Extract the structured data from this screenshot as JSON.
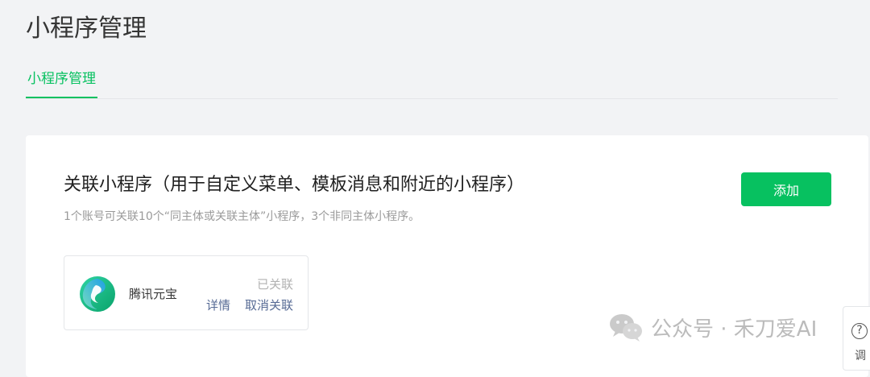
{
  "page": {
    "title": "小程序管理"
  },
  "tabs": [
    {
      "label": "小程序管理",
      "active": true
    }
  ],
  "section": {
    "title": "关联小程序（用于自定义菜单、模板消息和附近的小程序）",
    "description": "1个账号可关联10个“同主体或关联主体”小程序，3个非同主体小程序。",
    "add_button_label": "添加"
  },
  "linked_mini_programs": [
    {
      "name": "腾讯元宝",
      "status": "已关联",
      "details_label": "详情",
      "unlink_label": "取消关联",
      "logo_icon": "tencent-yuanbao-logo-icon"
    }
  ],
  "watermark": {
    "text": "公众号 · 禾刀爱AI",
    "icon": "wechat-icon"
  },
  "help_float": {
    "icon_glyph": "?",
    "label": "调"
  },
  "colors": {
    "accent": "#07c160",
    "link": "#576b95",
    "background": "#f2f3f5",
    "muted_text": "#9a9a9a"
  }
}
